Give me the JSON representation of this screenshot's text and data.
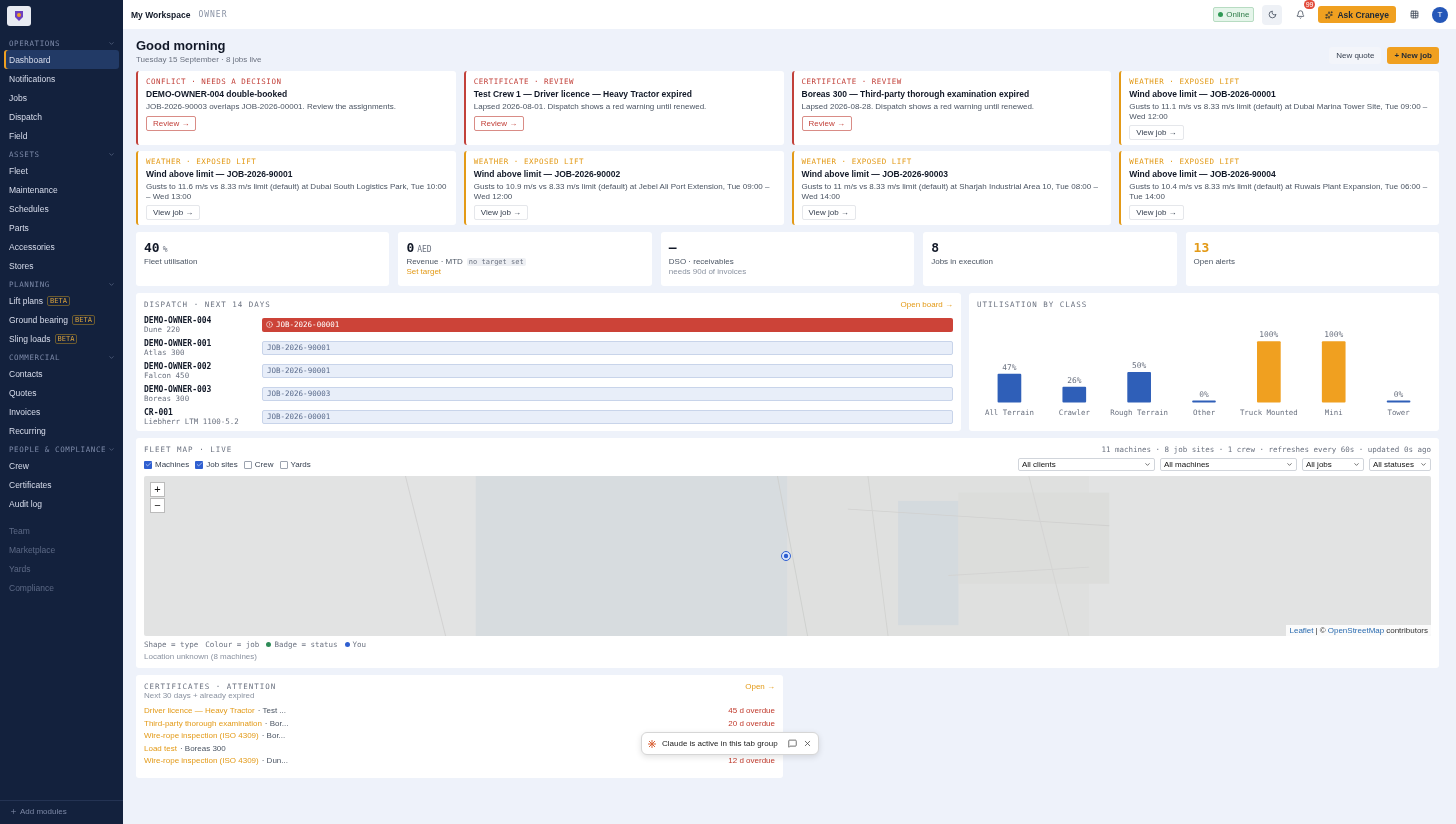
{
  "sidebar": {
    "sections": [
      {
        "title": "OPERATIONS",
        "items": [
          {
            "label": "Dashboard",
            "selected": true
          },
          {
            "label": "Notifications",
            "selected": false
          },
          {
            "label": "Jobs",
            "selected": false
          },
          {
            "label": "Dispatch",
            "selected": false
          },
          {
            "label": "Field",
            "selected": false
          }
        ]
      },
      {
        "title": "ASSETS",
        "items": [
          {
            "label": "Fleet",
            "selected": false
          },
          {
            "label": "Maintenance",
            "selected": false
          },
          {
            "label": "Schedules",
            "selected": false
          },
          {
            "label": "Parts",
            "selected": false
          },
          {
            "label": "Accessories",
            "selected": false
          },
          {
            "label": "Stores",
            "selected": false
          }
        ]
      },
      {
        "title": "PLANNING",
        "items": [
          {
            "label": "Lift plans",
            "selected": false,
            "badge": "BETA"
          },
          {
            "label": "Ground bearing",
            "selected": false,
            "badge": "BETA"
          },
          {
            "label": "Sling loads",
            "selected": false,
            "badge": "BETA"
          }
        ]
      },
      {
        "title": "COMMERCIAL",
        "items": [
          {
            "label": "Contacts",
            "selected": false
          },
          {
            "label": "Quotes",
            "selected": false
          },
          {
            "label": "Invoices",
            "selected": false
          },
          {
            "label": "Recurring",
            "selected": false
          }
        ]
      },
      {
        "title": "PEOPLE & COMPLIANCE",
        "items": [
          {
            "label": "Crew",
            "selected": false
          },
          {
            "label": "Certificates",
            "selected": false
          },
          {
            "label": "Audit log",
            "selected": false
          }
        ]
      }
    ],
    "extra_items": [
      {
        "label": "Team",
        "disabled": true
      },
      {
        "label": "Marketplace",
        "disabled": true
      },
      {
        "label": "Yards",
        "disabled": true
      },
      {
        "label": "Compliance",
        "disabled": true
      }
    ],
    "add_modules": "Add modules"
  },
  "header": {
    "workspace": "My Workspace",
    "role": "OWNER",
    "status": "Online",
    "notifications": "99",
    "ask_button": "Ask Craneye",
    "avatar": "T"
  },
  "greeting": {
    "title": "Good morning",
    "subtitle": "Tuesday 15 September · 8 jobs live",
    "buttons": [
      {
        "label": "New quote",
        "kind": "secondary"
      },
      {
        "label": "+ New job",
        "kind": "primary"
      }
    ]
  },
  "alerts": [
    {
      "kind": "critical",
      "tag": "CONFLICT · NEEDS A DECISION",
      "title": "DEMO-OWNER-004 double-booked",
      "text": "JOB-2026-90003 overlaps JOB-2026-00001. Review the assignments.",
      "action": "Review →"
    },
    {
      "kind": "critical",
      "tag": "CERTIFICATE · REVIEW",
      "title": "Test Crew 1 — Driver licence — Heavy Tractor expired",
      "text": "Lapsed 2026-08-01. Dispatch shows a red warning until renewed.",
      "action": "Review →"
    },
    {
      "kind": "critical",
      "tag": "CERTIFICATE · REVIEW",
      "title": "Boreas 300 — Third-party thorough examination expired",
      "text": "Lapsed 2026-08-28. Dispatch shows a red warning until renewed.",
      "action": "Review →"
    },
    {
      "kind": "warning",
      "tag": "WEATHER · EXPOSED LIFT",
      "title": "Wind above limit — JOB-2026-00001",
      "text": "Gusts to 11.1 m/s vs 8.33 m/s limit (default) at Dubai Marina Tower Site, Tue 09:00 – Wed 12:00",
      "action": "View job →"
    },
    {
      "kind": "warning",
      "tag": "WEATHER · EXPOSED LIFT",
      "title": "Wind above limit — JOB-2026-90001",
      "text": "Gusts to 11.6 m/s vs 8.33 m/s limit (default) at Dubai South Logistics Park, Tue 10:00 – Wed 13:00",
      "action": "View job →"
    },
    {
      "kind": "warning",
      "tag": "WEATHER · EXPOSED LIFT",
      "title": "Wind above limit — JOB-2026-90002",
      "text": "Gusts to 10.9 m/s vs 8.33 m/s limit (default) at Jebel Ali Port Extension, Tue 09:00 – Wed 12:00",
      "action": "View job →"
    },
    {
      "kind": "warning",
      "tag": "WEATHER · EXPOSED LIFT",
      "title": "Wind above limit — JOB-2026-90003",
      "text": "Gusts to 11 m/s vs 8.33 m/s limit (default) at Sharjah Industrial Area 10, Tue 08:00 – Wed 14:00",
      "action": "View job →"
    },
    {
      "kind": "warning",
      "tag": "WEATHER · EXPOSED LIFT",
      "title": "Wind above limit — JOB-2026-90004",
      "text": "Gusts to 10.4 m/s vs 8.33 m/s limit (default) at Ruwais Plant Expansion, Tue 06:00 – Tue 14:00",
      "action": "View job →"
    }
  ],
  "kpis": [
    {
      "value": "40",
      "unit": "%",
      "label": "Fleet utilisation",
      "highlight": false
    },
    {
      "value": "0",
      "unit": "AED",
      "label": "Revenue · MTD",
      "tag": "no target set",
      "link": "Set target",
      "highlight": false
    },
    {
      "value": "—",
      "label": "DSO · receivables",
      "note": "needs 90d of invoices",
      "highlight": false
    },
    {
      "value": "8",
      "label": "Jobs in execution",
      "highlight": false
    },
    {
      "value": "13",
      "label": "Open alerts",
      "highlight": true
    }
  ],
  "dispatch": {
    "title": "DISPATCH · NEXT 14 DAYS",
    "link": "Open board →",
    "rows": [
      {
        "machine": "DEMO-OWNER-004",
        "model": "Dune 220",
        "job": "JOB-2026-00001",
        "kind": "conflict"
      },
      {
        "machine": "DEMO-OWNER-001",
        "model": "Atlas 300",
        "job": "JOB-2026-90001",
        "kind": "normal"
      },
      {
        "machine": "DEMO-OWNER-002",
        "model": "Falcon 450",
        "job": "JOB-2026-90001",
        "kind": "normal"
      },
      {
        "machine": "DEMO-OWNER-003",
        "model": "Boreas 300",
        "job": "JOB-2026-90003",
        "kind": "normal"
      },
      {
        "machine": "CR-001",
        "model": "Liebherr LTM 1100-5.2",
        "job": "JOB-2026-00001",
        "kind": "normal"
      }
    ]
  },
  "utilisation": {
    "title": "UTILISATION BY CLASS",
    "chart_data": {
      "type": "bar",
      "categories": [
        "All Terrain",
        "Crawler",
        "Rough Terrain",
        "Other",
        "Truck Mounted",
        "Mini",
        "Tower"
      ],
      "values": [
        47,
        26,
        50,
        0,
        100,
        100,
        0
      ],
      "value_labels": [
        "47%",
        "26%",
        "50%",
        "0%",
        "100%",
        "100%",
        "0%"
      ]
    }
  },
  "fleet_map": {
    "title": "FLEET MAP · LIVE",
    "summary": "11 machines · 8 job sites · 1 crew · refreshes every 60s · updated 0s ago",
    "layers": [
      {
        "label": "Machines",
        "checked": true
      },
      {
        "label": "Job sites",
        "checked": true
      },
      {
        "label": "Crew",
        "checked": false
      },
      {
        "label": "Yards",
        "checked": false
      }
    ],
    "filters": [
      {
        "value": "All clients",
        "kind": "wide"
      },
      {
        "value": "All machines",
        "kind": "wide"
      },
      {
        "value": "All jobs",
        "kind": "narrow"
      },
      {
        "value": "All statuses",
        "kind": "narrow"
      }
    ],
    "zoom_in": "+",
    "zoom_out": "−",
    "attribution_leaflet": "Leaflet",
    "attribution_sep": "| ©",
    "attribution_osm": "OpenStreetMap",
    "attribution_tail": "contributors",
    "legend": [
      {
        "label": "Shape = type"
      },
      {
        "label": "Colour = job"
      },
      {
        "label": "Badge = status",
        "color": "#2e8b57"
      },
      {
        "label": "You",
        "color": "#2f5fd0"
      }
    ],
    "note": "Location unknown (8 machines)"
  },
  "certificates": {
    "title": "CERTIFICATES · ATTENTION",
    "subtitle": "Next 30 days + already expired",
    "link": "Open →",
    "rows": [
      {
        "name": "Driver licence — Heavy Tractor",
        "subject": "· Test ...",
        "due": "45 d overdue"
      },
      {
        "name": "Third-party thorough examination",
        "subject": "· Bor...",
        "due": "20 d overdue"
      },
      {
        "name": "Wire-rope inspection (ISO 4309)",
        "subject": "· Bor..."
      },
      {
        "name": "Load test",
        "subject": "· Boreas 300"
      },
      {
        "name": "Wire-rope inspection (ISO 4309)",
        "subject": "· Dun...",
        "due": "12 d overdue"
      }
    ]
  },
  "toast": {
    "text": "Claude is active in this tab group"
  }
}
